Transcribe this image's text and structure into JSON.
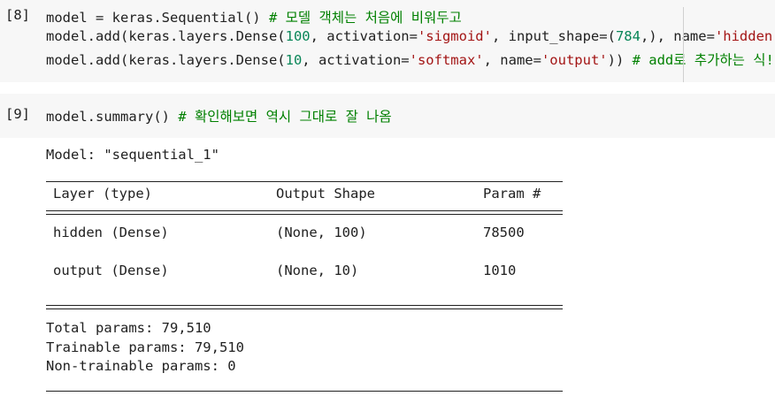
{
  "cells": [
    {
      "prompt": "[8]",
      "lines": [
        [
          {
            "t": "model = keras.Sequential() ",
            "c": "kw"
          },
          {
            "t": "# 모델 객체는 처음에 비워두고",
            "c": "cmt"
          }
        ],
        [
          {
            "t": "model.add(keras.layers.Dense(",
            "c": "kw"
          },
          {
            "t": "100",
            "c": "num"
          },
          {
            "t": ", activation=",
            "c": "kw"
          },
          {
            "t": "'sigmoid'",
            "c": "str"
          },
          {
            "t": ", input_shape=(",
            "c": "kw"
          },
          {
            "t": "784",
            "c": "num"
          },
          {
            "t": ",), name=",
            "c": "kw"
          },
          {
            "t": "'hidden'",
            "c": "str"
          },
          {
            "t": "))",
            "c": "kw"
          }
        ],
        [
          {
            "t": "model.add(keras.layers.Dense(",
            "c": "kw"
          },
          {
            "t": "10",
            "c": "num"
          },
          {
            "t": ", activation=",
            "c": "kw"
          },
          {
            "t": "'softmax'",
            "c": "str"
          },
          {
            "t": ", name=",
            "c": "kw"
          },
          {
            "t": "'output'",
            "c": "str"
          },
          {
            "t": ")) ",
            "c": "kw"
          },
          {
            "t": "# add로 추가하는 식!",
            "c": "cmt"
          }
        ]
      ]
    },
    {
      "prompt": "[9]",
      "lines": [
        [
          {
            "t": "model.summary() ",
            "c": "kw"
          },
          {
            "t": "# 확인해보면 역시 그대로 잘 나옴",
            "c": "cmt"
          }
        ]
      ]
    }
  ],
  "output": {
    "model_title": "Model: \"sequential_1\"",
    "headers": {
      "layer": "Layer (type)",
      "shape": "Output Shape",
      "param": "Param #"
    },
    "rows": [
      {
        "layer": "hidden (Dense)",
        "shape": "(None, 100)",
        "param": "78500"
      },
      {
        "layer": "output (Dense)",
        "shape": "(None, 10)",
        "param": "1010"
      }
    ],
    "total": "Total params: 79,510",
    "trainable": "Trainable params: 79,510",
    "non_trainable": "Non-trainable params: 0"
  }
}
